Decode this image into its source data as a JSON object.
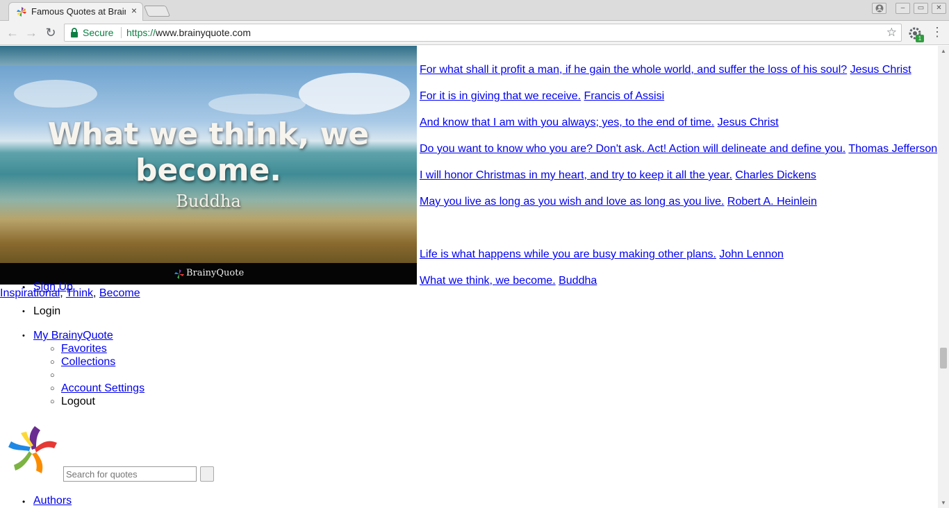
{
  "browser": {
    "tab_title": "Famous Quotes at BrainyQuote",
    "tab_close": "×",
    "security_label": "Secure",
    "url_scheme": "https://",
    "url_rest": "www.brainyquote.com",
    "extension_badge": "1",
    "back_icon": "←",
    "forward_icon": "→",
    "reload_icon": "↻",
    "star_icon": "☆",
    "menu_icon": "⋮",
    "window_buttons": {
      "minimize": "–",
      "maximize": "▭",
      "close": "✕"
    }
  },
  "hero": {
    "quote": "What we think, we become.",
    "author": "Buddha",
    "brand": "BrainyQuote"
  },
  "quotes": [
    {
      "text": "For what shall it profit a man, if he gain the whole world, and suffer the loss of his soul?",
      "author": "Jesus Christ"
    },
    {
      "text": "For it is in giving that we receive.",
      "author": "Francis of Assisi"
    },
    {
      "text": "And know that I am with you always; yes, to the end of time.",
      "author": "Jesus Christ"
    },
    {
      "text": "Do you want to know who you are? Don't ask. Act! Action will delineate and define you.",
      "author": "Thomas Jefferson"
    },
    {
      "text": "I will honor Christmas in my heart, and try to keep it all the year.",
      "author": "Charles Dickens"
    },
    {
      "text": "May you live as long as you wish and love as long as you live.",
      "author": "Robert A. Heinlein"
    },
    {
      "text": "Life is what happens while you are busy making other plans.",
      "author": "John Lennon"
    },
    {
      "text": "What we think, we become.",
      "author": "Buddha"
    }
  ],
  "tags": [
    "Inspirational",
    "Think",
    "Become"
  ],
  "nav": {
    "sign_up": "Sign Up",
    "login": "Login",
    "my_brainyquote": "My BrainyQuote",
    "submenu": {
      "favorites": "Favorites",
      "collections": "Collections",
      "account_settings": "Account Settings",
      "logout": "Logout"
    },
    "authors": "Authors"
  },
  "search": {
    "placeholder": "Search for quotes"
  },
  "colors": {
    "link": "#0000ee",
    "secure": "#0b8043",
    "ext_badge": "#2e9e3e"
  }
}
